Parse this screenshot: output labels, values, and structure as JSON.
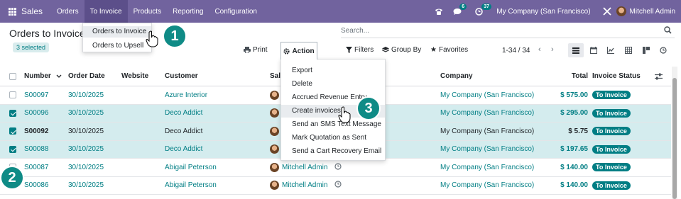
{
  "navbar": {
    "app_name": "Sales",
    "menu": [
      "Orders",
      "To Invoice",
      "Products",
      "Reporting",
      "Configuration"
    ],
    "active_menu": "To Invoice",
    "messages_count": "6",
    "activities_count": "37",
    "company": "My Company (San Francisco)",
    "user": "Mitchell Admin"
  },
  "breadcrumb": "Orders to Invoice",
  "selected_text": "3 selected",
  "search_placeholder": "Search...",
  "toolbar": {
    "print": "Print",
    "action": "Action",
    "filters": "Filters",
    "group_by": "Group By",
    "favorites": "Favorites",
    "pager": "1-34 / 34"
  },
  "to_invoice_menu": [
    "Orders to Invoice",
    "Orders to Upsell"
  ],
  "action_menu": [
    "Export",
    "Delete",
    "Accrued Revenue Entry",
    "Create invoices",
    "Send an SMS Text Message",
    "Mark Quotation as Sent",
    "Send a Cart Recovery Email"
  ],
  "columns": {
    "number": "Number",
    "order_date": "Order Date",
    "website": "Website",
    "customer": "Customer",
    "salesperson": "Salesperson",
    "company": "Company",
    "total": "Total",
    "invoice_status": "Invoice Status"
  },
  "rows": [
    {
      "number": "S00097",
      "date": "30/10/2025",
      "customer": "Azure Interior",
      "salesperson": "",
      "company": "My Company (San Francisco)",
      "total": "$ 575.00",
      "status": "To Invoice",
      "selected": false
    },
    {
      "number": "S00096",
      "date": "30/10/2025",
      "customer": "Deco Addict",
      "salesperson": "",
      "company": "My Company (San Francisco)",
      "total": "$ 295.00",
      "status": "To Invoice",
      "selected": true
    },
    {
      "number": "S00092",
      "date": "30/10/2025",
      "customer": "Deco Addict",
      "salesperson": "",
      "company": "My Company (San Francisco)",
      "total": "$ 5.75",
      "status": "To Invoice",
      "selected": true
    },
    {
      "number": "S00088",
      "date": "30/10/2025",
      "customer": "Deco Addict",
      "salesperson": "",
      "company": "My Company (San Francisco)",
      "total": "$ 197.65",
      "status": "To Invoice",
      "selected": true
    },
    {
      "number": "S00087",
      "date": "30/10/2025",
      "customer": "Abigail Peterson",
      "salesperson": "Mitchell Admin",
      "company": "My Company (San Francisco)",
      "total": "$ 140.00",
      "status": "To Invoice",
      "selected": false
    },
    {
      "number": "S00086",
      "date": "30/10/2025",
      "customer": "Abigail Peterson",
      "salesperson": "Mitchell Admin",
      "company": "My Company (San Francisco)",
      "total": "$ 140.00",
      "status": "To Invoice",
      "selected": false
    }
  ],
  "callouts": [
    "1",
    "2",
    "3"
  ],
  "colors": {
    "navbar": "#71639e",
    "accent": "#017e84",
    "callout": "#0f8b86",
    "selected_row": "#d4ecee"
  }
}
